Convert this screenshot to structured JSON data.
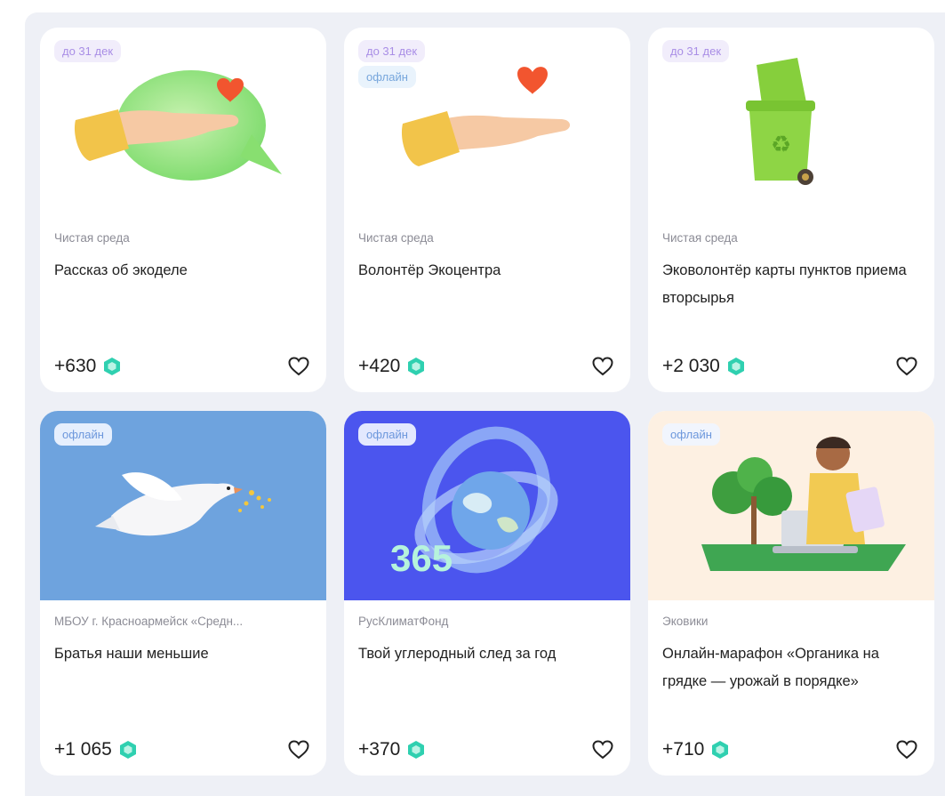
{
  "cards": [
    {
      "badges": {
        "date": "до 31 дек"
      },
      "org": "Чистая среда",
      "title": "Рассказ об экоделе",
      "points": "+630",
      "icon": "hand-heart-chat-illustration"
    },
    {
      "badges": {
        "date": "до 31 дек",
        "offline": "офлайн"
      },
      "org": "Чистая среда",
      "title": "Волонтёр Экоцентра",
      "points": "+420",
      "icon": "hand-heart-illustration"
    },
    {
      "badges": {
        "date": "до 31 дек"
      },
      "org": "Чистая среда",
      "title": "Эковолонтёр карты пунктов приема вторсырья",
      "points": "+2 030",
      "icon": "recycle-bin-illustration"
    },
    {
      "badges": {
        "offline": "офлайн"
      },
      "org": "МБОУ г. Красноармейск «Средн...",
      "title": "Братья наши меньшие",
      "points": "+1 065",
      "icon": "dove-illustration"
    },
    {
      "badges": {
        "offline": "офлайн"
      },
      "org": "РусКлиматФонд",
      "title": "Твой углеродный след за год",
      "points": "+370",
      "icon": "globe-365-illustration",
      "image_text": "365"
    },
    {
      "badges": {
        "offline": "офлайн"
      },
      "org": "Эковики",
      "title": "Онлайн-марафон «Органика на грядке — урожай в порядке»",
      "points": "+710",
      "icon": "boy-laptop-illustration"
    }
  ],
  "colors": {
    "panel": "#eef0f6",
    "gem": "#2fd0b0",
    "accent_blue": "#4b55ee",
    "dove_bg": "#6ea3de",
    "boy_bg": "#fdf0e2"
  }
}
